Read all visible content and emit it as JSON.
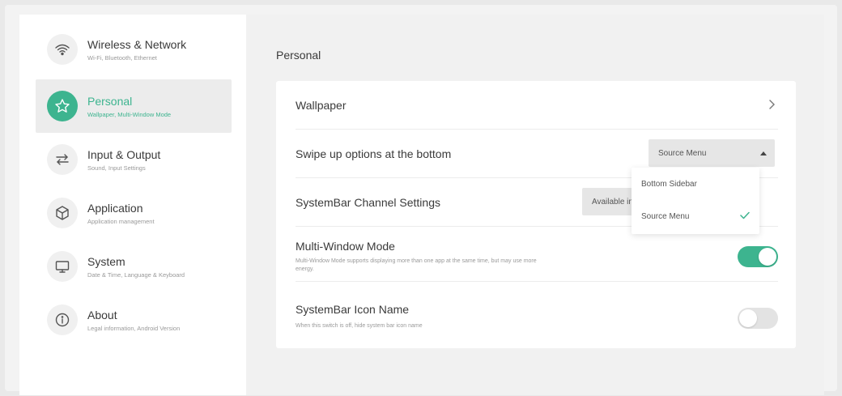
{
  "sidebar": {
    "items": [
      {
        "title": "Wireless & Network",
        "subtitle": "Wi-Fi, Bluetooth, Ethernet",
        "icon": "wifi-icon",
        "active": false
      },
      {
        "title": "Personal",
        "subtitle": "Wallpaper, Multi-Window Mode",
        "icon": "star-icon",
        "active": true
      },
      {
        "title": "Input & Output",
        "subtitle": "Sound, Input Settings",
        "icon": "swap-arrows-icon",
        "active": false
      },
      {
        "title": "Application",
        "subtitle": "Application management",
        "icon": "cube-icon",
        "active": false
      },
      {
        "title": "System",
        "subtitle": "Date & Time, Language & Keyboard",
        "icon": "monitor-icon",
        "active": false
      },
      {
        "title": "About",
        "subtitle": "Legal information, Android Version",
        "icon": "info-icon",
        "active": false
      }
    ]
  },
  "main": {
    "title": "Personal",
    "wallpaper": {
      "label": "Wallpaper"
    },
    "swipe_up": {
      "label": "Swipe up options at the bottom",
      "value": "Source Menu"
    },
    "systembar_channel": {
      "label": "SystemBar Channel Settings",
      "value": "Available in a"
    },
    "multi_window": {
      "label": "Multi-Window Mode",
      "description": "Multi-Window Mode supports displaying more than one app at the same time, but may use more energy.",
      "enabled": true
    },
    "systembar_icon_name": {
      "label": "SystemBar Icon Name",
      "description": "When this switch is off, hide system bar icon name",
      "enabled": false
    }
  },
  "dropdown": {
    "options": [
      {
        "label": "Bottom Sidebar",
        "selected": false
      },
      {
        "label": "Source Menu",
        "selected": true
      }
    ]
  },
  "colors": {
    "accent": "#3db48f",
    "background": "#f1f1f1",
    "card": "#ffffff"
  }
}
